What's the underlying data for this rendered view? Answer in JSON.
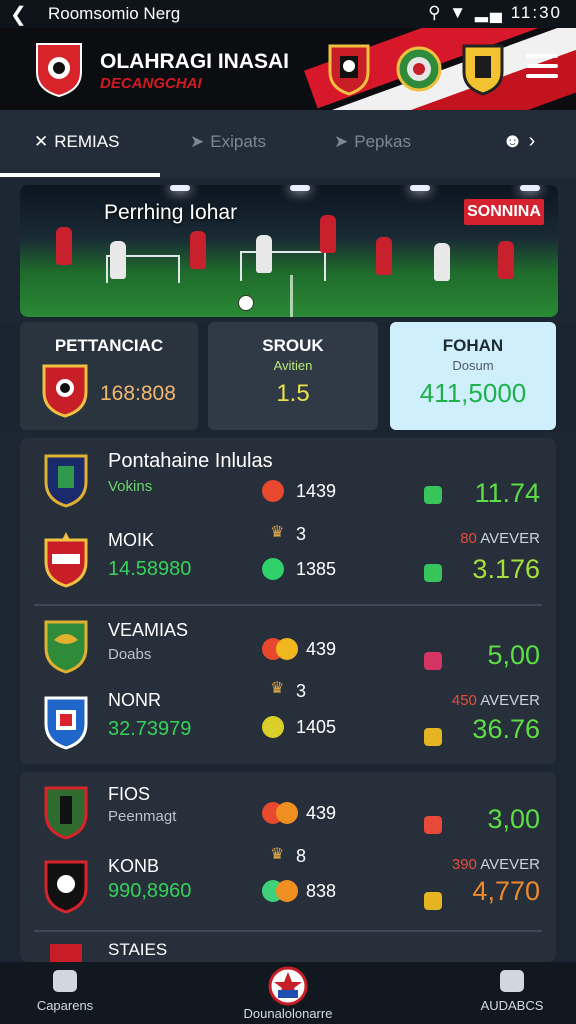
{
  "status_bar": {
    "title": "Roomsomio Nerg",
    "time": "11:30",
    "back_icon": "back-arrow-icon",
    "icons": [
      "search-icon",
      "wifi-icon",
      "signal-icon"
    ]
  },
  "header": {
    "app_title": "OLAHRAGI INASAI",
    "app_subtitle": "DECANGCHAI",
    "menu_icon": "hamburger-menu-icon",
    "colors": {
      "accent": "#d21a23",
      "stripe_white": "#f1f1f1"
    }
  },
  "tabs": [
    {
      "label": "REMIAS",
      "icon": "close-x-icon",
      "active": true
    },
    {
      "label": "Exipats",
      "icon": "send-icon",
      "active": false
    },
    {
      "label": "Pepkas",
      "icon": "send-icon",
      "active": false
    }
  ],
  "tabs_right_icon": "user-chevron-icon",
  "hero": {
    "title": "Perrhing Iohar",
    "badge": "SONNINA"
  },
  "summary": {
    "card1": {
      "label": "PETTANCIAC",
      "value": "168:808"
    },
    "card2": {
      "label": "SROUK",
      "sub": "Avitien",
      "value": "1.5"
    },
    "card3": {
      "label": "FOHAN",
      "sub": "Dosum",
      "value": "411,5000"
    }
  },
  "matches": [
    {
      "group_title": "Pontahaine Inlulas",
      "rows": [
        {
          "team": "",
          "sub": "Vokins",
          "dot_color": "#e8482e",
          "score": "1439",
          "odd": "11.74",
          "odd_color": "#5cde45",
          "mini": "",
          "mini_words": "",
          "icon_color": "#37c45a"
        },
        {
          "team": "MOIK",
          "sub": "14.58980",
          "dot_color": "#2fd16a",
          "score": "1385",
          "odd": "3.176",
          "odd_color": "#a6e03c",
          "mini": "80",
          "mini_words": "AVEVER",
          "icon_color": "#37c45a",
          "mid": "3"
        }
      ]
    },
    {
      "group_title": "VEAMIAS",
      "rows": [
        {
          "team": "",
          "sub": "Doabs",
          "dot_color": "#f0b71f",
          "score": "439",
          "odd": "5,00",
          "odd_color": "#5cde45",
          "mini": "",
          "mini_words": "",
          "icon_color": "#d43565"
        },
        {
          "team": "NONR",
          "sub": "32.73979",
          "dot_color": "#d9cf28",
          "score": "1405",
          "odd": "36.76",
          "odd_color": "#5cde45",
          "mini": "450",
          "mini_words": "AVEVER",
          "icon_color": "#e4b423",
          "mid": "3"
        }
      ]
    },
    {
      "group_title": "FIOS",
      "rows": [
        {
          "team": "",
          "sub": "Peenmagt",
          "dot_color": "#ef8f22",
          "score": "439",
          "odd": "3,00",
          "odd_color": "#5cde45",
          "mini": "",
          "mini_words": "",
          "icon_color": "#e84a3a"
        },
        {
          "team": "KONB",
          "sub": "990,8960",
          "dot_color": "#3fd07a",
          "score": "838",
          "odd": "4,770",
          "odd_color": "#ef8a2c",
          "mini": "390",
          "mini_words": "AVEVER",
          "icon_color": "#e4b423",
          "mid": "8"
        }
      ]
    }
  ],
  "partial_group_title": "STAIES",
  "bottom_nav": [
    {
      "label": "Caparens",
      "icon": "home-icon"
    },
    {
      "label": "Dounalolonarre",
      "icon": "flag-badge-icon"
    },
    {
      "label": "AUDABCS",
      "icon": "camera-icon"
    }
  ]
}
